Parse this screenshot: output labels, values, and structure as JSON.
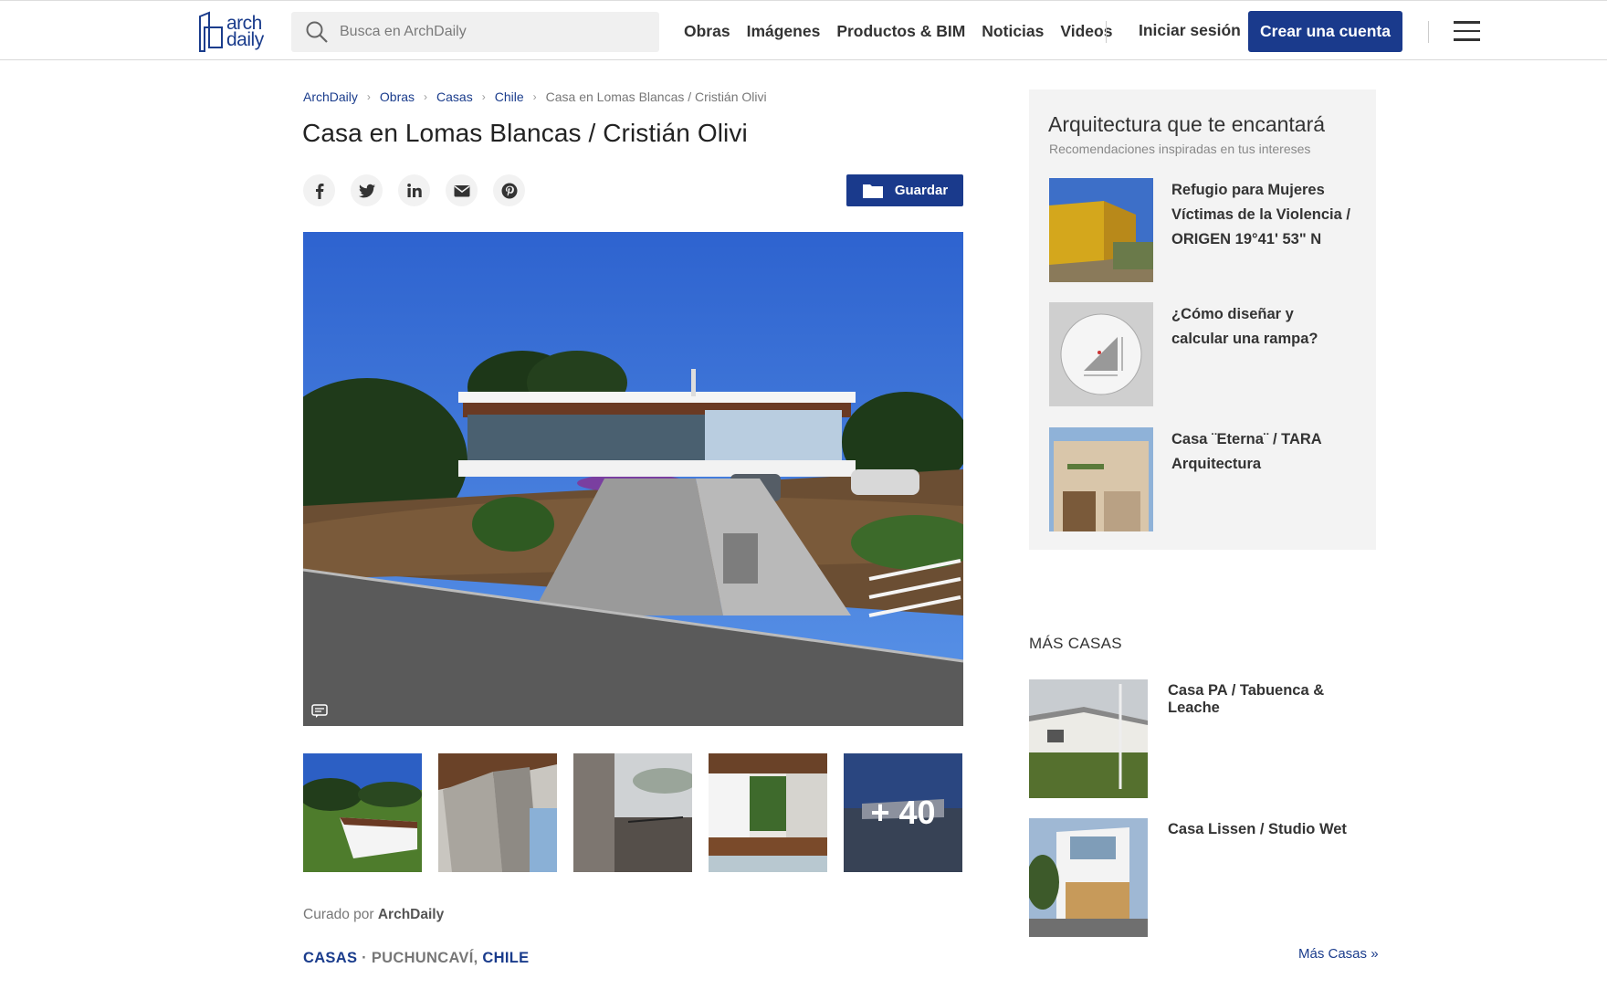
{
  "header": {
    "logo_top": "arch",
    "logo_bottom": "daily",
    "search_placeholder": "Busca en ArchDaily",
    "nav": [
      "Obras",
      "Imágenes",
      "Productos & BIM",
      "Noticias",
      "Videos"
    ],
    "login": "Iniciar sesión",
    "cta": "Crear una cuenta"
  },
  "breadcrumb": [
    "ArchDaily",
    "Obras",
    "Casas",
    "Chile"
  ],
  "breadcrumb_current": "Casa en Lomas Blancas / Cristián Olivi",
  "title": "Casa en Lomas Blancas / Cristián Olivi",
  "share_icons": [
    "facebook-icon",
    "twitter-icon",
    "linkedin-icon",
    "email-icon",
    "pinterest-icon"
  ],
  "save_label": "Guardar",
  "thumbs_more": "+ 40",
  "curated": {
    "prefix": "Curado por ",
    "name": "ArchDaily"
  },
  "categories": {
    "type": "CASAS",
    "dot": " · ",
    "city": "PUCHUNCAVÍ",
    "comma": ", ",
    "country": "CHILE"
  },
  "recommend": {
    "title": "Arquitectura que te encantará",
    "subtitle": "Recomendaciones inspiradas en tus intereses",
    "items": [
      "Refugio para Mujeres Víctimas de la Violencia / ORIGEN 19°41' 53\" N",
      "¿Cómo diseñar y calcular una rampa?",
      "Casa ¨Eterna¨ / TARA Arquitectura"
    ]
  },
  "more": {
    "heading": "MÁS CASAS",
    "items": [
      "Casa PA / Tabuenca & Leache",
      "Casa Lissen / Studio Wet"
    ],
    "link": "Más Casas »"
  },
  "colors": {
    "brand": "#1a3a8c",
    "link": "#1a3c8c"
  }
}
